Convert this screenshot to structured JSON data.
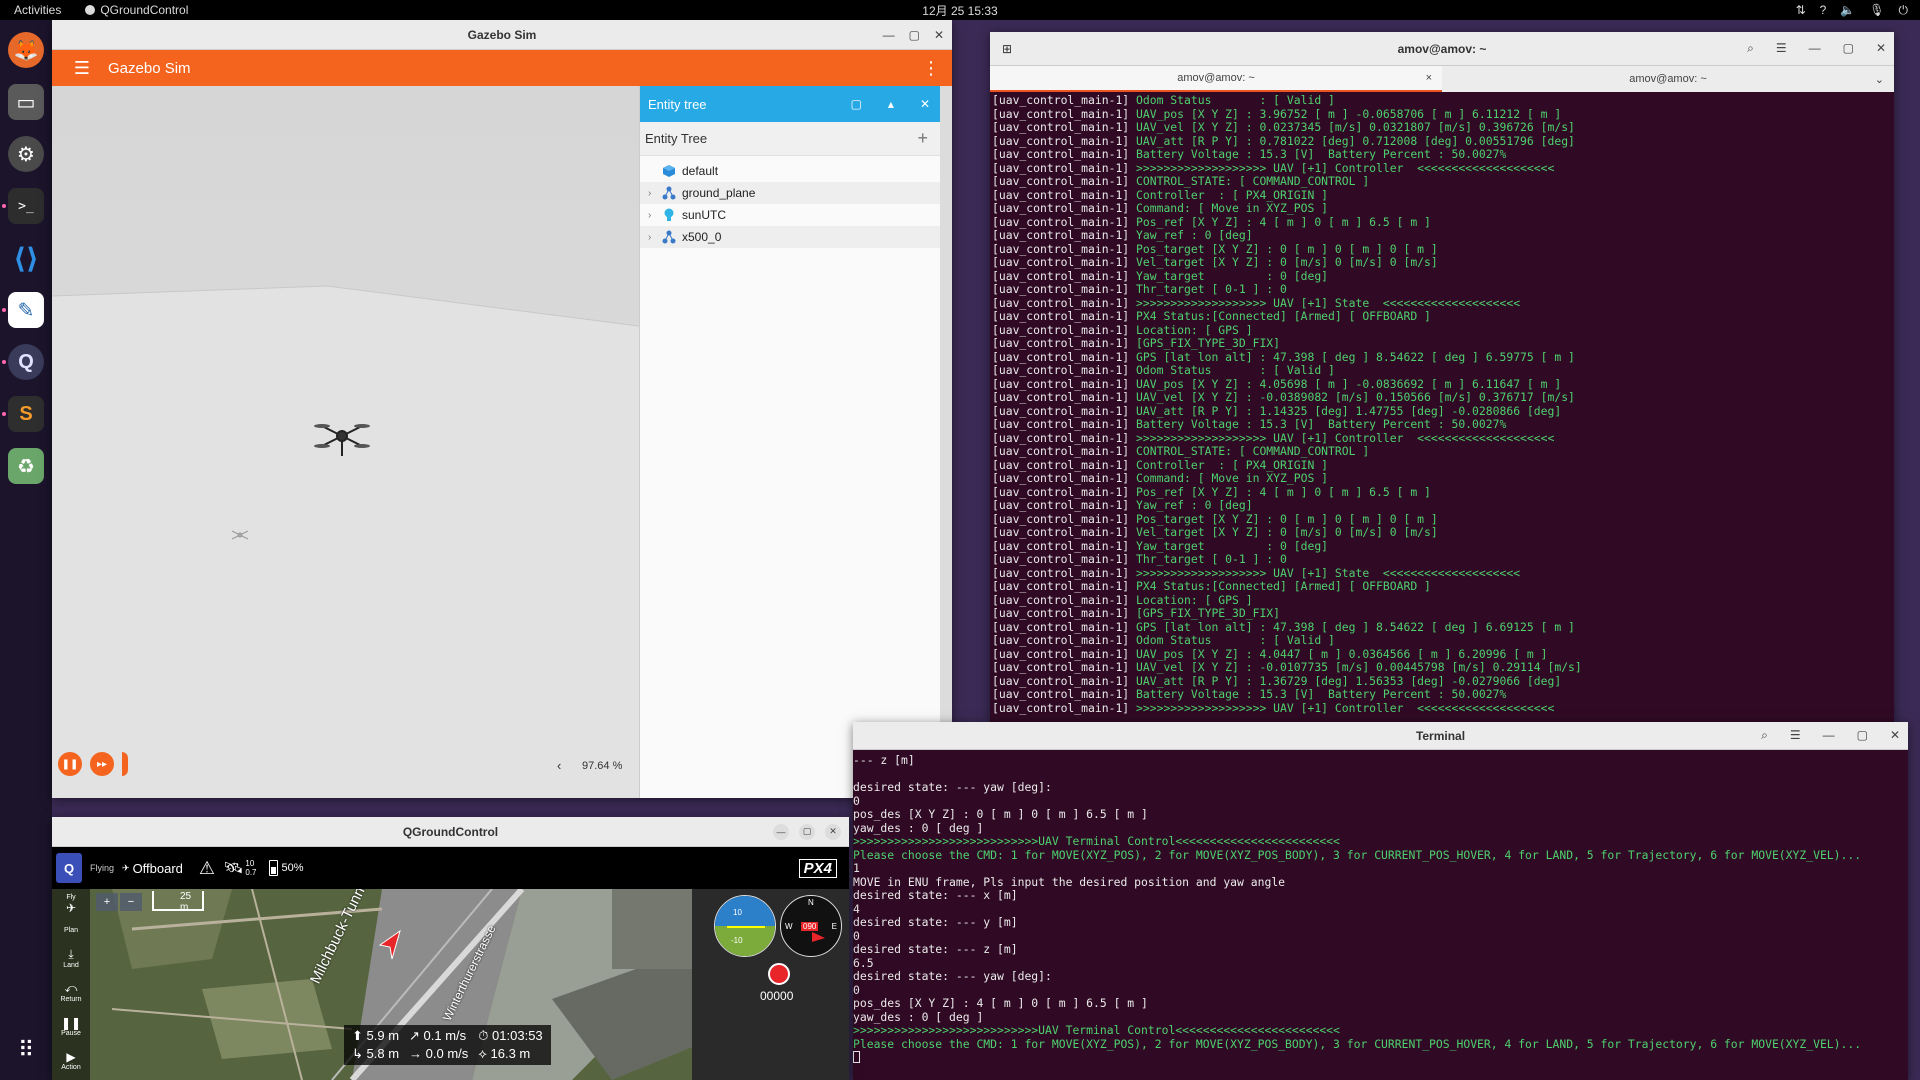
{
  "topbar": {
    "activities": "Activities",
    "app_name": "QGroundControl",
    "clock": "12月 25  15:33"
  },
  "dock": {
    "items": [
      {
        "name": "firefox-icon",
        "glyph": "🦊"
      },
      {
        "name": "files-icon",
        "glyph": "🗂"
      },
      {
        "name": "settings-icon",
        "glyph": "⚙"
      },
      {
        "name": "terminal-icon",
        "glyph": ">_"
      },
      {
        "name": "vscode-icon",
        "glyph": "⟨⟩"
      },
      {
        "name": "text-editor-icon",
        "glyph": "✎"
      },
      {
        "name": "qgroundcontrol-icon",
        "glyph": "Q"
      },
      {
        "name": "sublime-icon",
        "glyph": "S"
      },
      {
        "name": "trash-icon",
        "glyph": "♻"
      }
    ],
    "apps_grid": "⋮⋮⋮"
  },
  "gazebo": {
    "window_title": "Gazebo Sim",
    "app_title": "Gazebo Sim",
    "entity_panel_title": "Entity tree",
    "entity_tree_label": "Entity Tree",
    "entities": [
      {
        "label": "default",
        "expandable": false,
        "color": "#2a8bd8"
      },
      {
        "label": "ground_plane",
        "expandable": true,
        "color": "#3a78c8"
      },
      {
        "label": "sunUTC",
        "expandable": true,
        "color": "#30b4e6"
      },
      {
        "label": "x500_0",
        "expandable": true,
        "color": "#3a78c8"
      }
    ],
    "rtf": "97.64 %",
    "rtf_chevron": "‹"
  },
  "terminal1": {
    "window_title": "amov@amov: ~",
    "tabs": [
      "amov@amov: ~",
      "amov@amov: ~"
    ],
    "prefix": "[uav_control_main-1]",
    "lines": [
      "Odom Status       : [ Valid ]",
      "UAV_pos [X Y Z] : 3.96752 [ m ] -0.0658706 [ m ] 6.11212 [ m ]",
      "UAV_vel [X Y Z] : 0.0237345 [m/s] 0.0321807 [m/s] 0.396726 [m/s]",
      "UAV_att [R P Y] : 0.781022 [deg] 0.712008 [deg] 0.00551796 [deg]",
      "Battery Voltage : 15.3 [V]  Battery Percent : 50.0027%",
      ">>>>>>>>>>>>>>>>>>> UAV [+1] Controller  <<<<<<<<<<<<<<<<<<<<",
      "CONTROL_STATE: [ COMMAND_CONTROL ]",
      "Controller  : [ PX4_ORIGIN ]",
      "Command: [ Move in XYZ_POS ]",
      "Pos_ref [X Y Z] : 4 [ m ] 0 [ m ] 6.5 [ m ]",
      "Yaw_ref : 0 [deg]",
      "Pos_target [X Y Z] : 0 [ m ] 0 [ m ] 0 [ m ]",
      "Vel_target [X Y Z] : 0 [m/s] 0 [m/s] 0 [m/s]",
      "Yaw_target         : 0 [deg]",
      "Thr_target [ 0-1 ] : 0",
      ">>>>>>>>>>>>>>>>>>> UAV [+1] State  <<<<<<<<<<<<<<<<<<<<",
      "PX4 Status:[Connected] [Armed] [ OFFBOARD ]",
      "Location: [ GPS ]",
      "[GPS_FIX_TYPE_3D_FIX]",
      "GPS [lat lon alt] : 47.398 [ deg ] 8.54622 [ deg ] 6.59775 [ m ]",
      "Odom Status       : [ Valid ]",
      "UAV_pos [X Y Z] : 4.05698 [ m ] -0.0836692 [ m ] 6.11647 [ m ]",
      "UAV_vel [X Y Z] : -0.0389082 [m/s] 0.150566 [m/s] 0.376717 [m/s]",
      "UAV_att [R P Y] : 1.14325 [deg] 1.47755 [deg] -0.0280866 [deg]",
      "Battery Voltage : 15.3 [V]  Battery Percent : 50.0027%",
      ">>>>>>>>>>>>>>>>>>> UAV [+1] Controller  <<<<<<<<<<<<<<<<<<<<",
      "CONTROL_STATE: [ COMMAND_CONTROL ]",
      "Controller  : [ PX4_ORIGIN ]",
      "Command: [ Move in XYZ_POS ]",
      "Pos_ref [X Y Z] : 4 [ m ] 0 [ m ] 6.5 [ m ]",
      "Yaw_ref : 0 [deg]",
      "Pos_target [X Y Z] : 0 [ m ] 0 [ m ] 0 [ m ]",
      "Vel_target [X Y Z] : 0 [m/s] 0 [m/s] 0 [m/s]",
      "Yaw_target         : 0 [deg]",
      "Thr_target [ 0-1 ] : 0",
      ">>>>>>>>>>>>>>>>>>> UAV [+1] State  <<<<<<<<<<<<<<<<<<<<",
      "PX4 Status:[Connected] [Armed] [ OFFBOARD ]",
      "Location: [ GPS ]",
      "[GPS_FIX_TYPE_3D_FIX]",
      "GPS [lat lon alt] : 47.398 [ deg ] 8.54622 [ deg ] 6.69125 [ m ]",
      "Odom Status       : [ Valid ]",
      "UAV_pos [X Y Z] : 4.0447 [ m ] 0.0364566 [ m ] 6.20996 [ m ]",
      "UAV_vel [X Y Z] : -0.0107735 [m/s] 0.00445798 [m/s] 0.29114 [m/s]",
      "UAV_att [R P Y] : 1.36729 [deg] 1.56353 [deg] -0.0279066 [deg]",
      "Battery Voltage : 15.3 [V]  Battery Percent : 50.0027%",
      ">>>>>>>>>>>>>>>>>>> UAV [+1] Controller  <<<<<<<<<<<<<<<<<<<<"
    ]
  },
  "terminal2": {
    "window_title": "Terminal",
    "lines": [
      {
        "t": "--- z [m]",
        "c": "w"
      },
      {
        "t": "",
        "c": "w"
      },
      {
        "t": "desired state: --- yaw [deg]:",
        "c": "w"
      },
      {
        "t": "0",
        "c": "w"
      },
      {
        "t": "pos_des [X Y Z] : 0 [ m ] 0 [ m ] 6.5 [ m ]",
        "c": "w"
      },
      {
        "t": "yaw_des : 0 [ deg ]",
        "c": "w"
      },
      {
        "t": ">>>>>>>>>>>>>>>>>>>>>>>>>>>UAV Terminal Control<<<<<<<<<<<<<<<<<<<<<<<<",
        "c": "g"
      },
      {
        "t": "Please choose the CMD: 1 for MOVE(XYZ_POS), 2 for MOVE(XYZ_POS_BODY), 3 for CURRENT_POS_HOVER, 4 for LAND, 5 for Trajectory, 6 for MOVE(XYZ_VEL)...",
        "c": "g"
      },
      {
        "t": "1",
        "c": "w"
      },
      {
        "t": "MOVE in ENU frame, Pls input the desired position and yaw angle",
        "c": "w"
      },
      {
        "t": "desired state: --- x [m]",
        "c": "w"
      },
      {
        "t": "4",
        "c": "w"
      },
      {
        "t": "desired state: --- y [m]",
        "c": "w"
      },
      {
        "t": "0",
        "c": "w"
      },
      {
        "t": "desired state: --- z [m]",
        "c": "w"
      },
      {
        "t": "6.5",
        "c": "w"
      },
      {
        "t": "desired state: --- yaw [deg]:",
        "c": "w"
      },
      {
        "t": "0",
        "c": "w"
      },
      {
        "t": "pos_des [X Y Z] : 4 [ m ] 0 [ m ] 6.5 [ m ]",
        "c": "w"
      },
      {
        "t": "yaw_des : 0 [ deg ]",
        "c": "w"
      },
      {
        "t": ">>>>>>>>>>>>>>>>>>>>>>>>>>>UAV Terminal Control<<<<<<<<<<<<<<<<<<<<<<<<",
        "c": "g"
      },
      {
        "t": "Please choose the CMD: 1 for MOVE(XYZ_POS), 2 for MOVE(XYZ_POS_BODY), 3 for CURRENT_POS_HOVER, 4 for LAND, 5 for Trajectory, 6 for MOVE(XYZ_VEL)...",
        "c": "g"
      }
    ]
  },
  "qgc": {
    "window_title": "QGroundControl",
    "flight_state": "Flying",
    "flight_mode": "Offboard",
    "gps_sats": "10",
    "gps_hdop": "0.7",
    "battery": "50%",
    "px4_logo": "PX4",
    "scale": "25 m",
    "left_tools": [
      {
        "label": "Fly",
        "glyph": "✈"
      },
      {
        "label": "Plan",
        "glyph": "⌖"
      },
      {
        "label": "Land",
        "glyph": "⤓"
      },
      {
        "label": "Return",
        "glyph": "⤺"
      },
      {
        "label": "Pause",
        "glyph": "❚❚"
      },
      {
        "label": "Action",
        "glyph": "▶"
      }
    ],
    "street_1": "Milchbuck-Tunnel",
    "street_2": "Winterthurerstrasse",
    "heading": "090",
    "compass_n": "N",
    "compass_e": "E",
    "compass_w": "W",
    "attitude_top": "10",
    "attitude_bottom": "-10",
    "record_counter": "00000",
    "stats": {
      "alt_rel": "5.9 m",
      "h_speed": "0.1 m/s",
      "flight_time": "01:03:53",
      "alt_msl": "5.8 m",
      "v_speed": "0.0 m/s",
      "dist_home": "16.3 m"
    }
  },
  "colors": {
    "gazebo_orange": "#f4641e",
    "entity_blue": "#27a9e6",
    "terminal_bg": "#300a24",
    "terminal_green": "#4ed06e"
  }
}
